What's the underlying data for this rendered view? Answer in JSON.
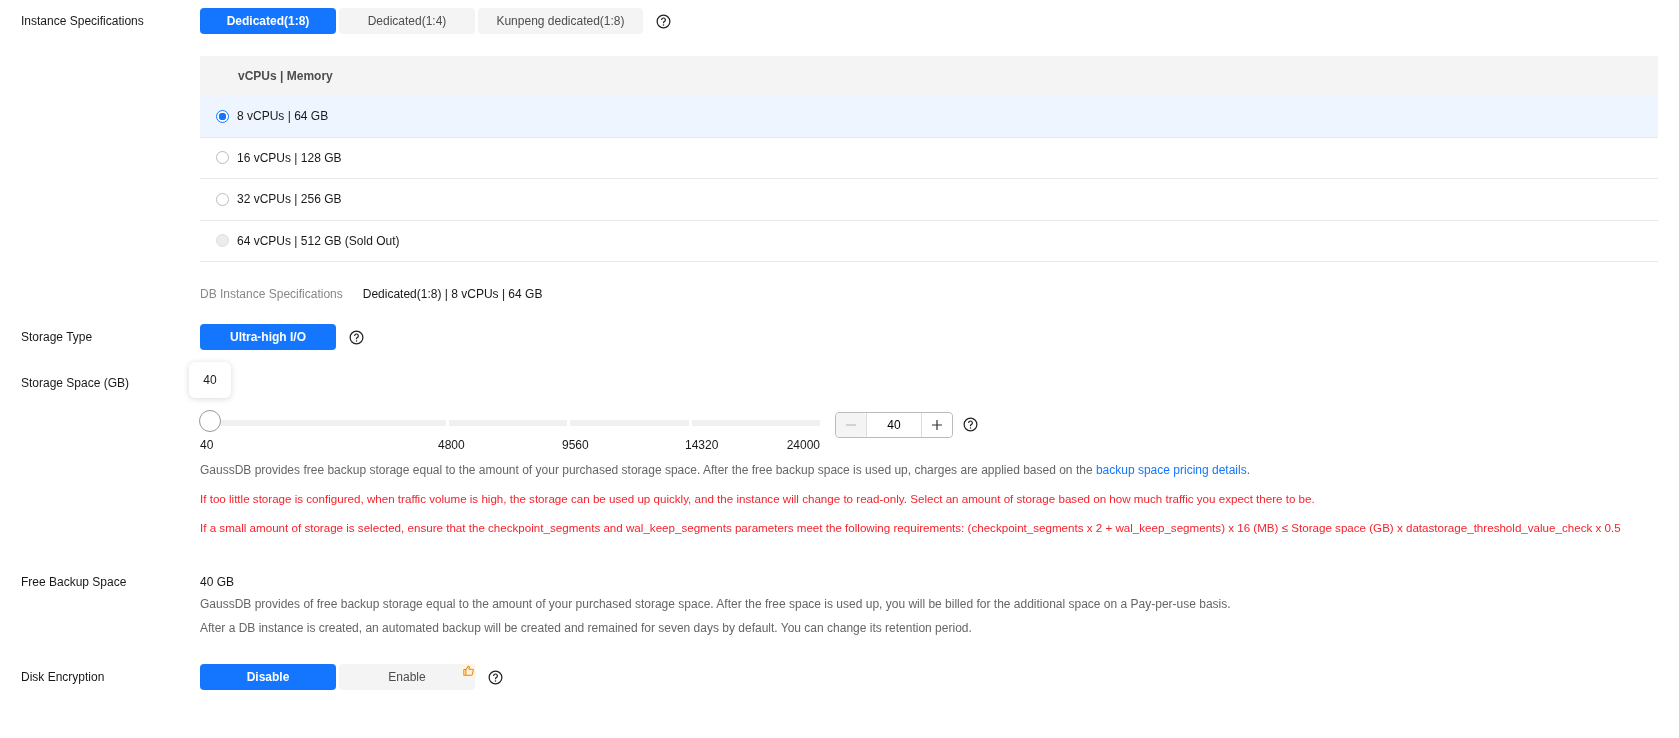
{
  "instance_specifications": {
    "label": "Instance Specifications",
    "options": [
      {
        "label": "Dedicated(1:8)",
        "selected": true
      },
      {
        "label": "Dedicated(1:4)",
        "selected": false
      },
      {
        "label": "Kunpeng dedicated(1:8)",
        "selected": false
      }
    ],
    "table": {
      "header": "vCPUs | Memory",
      "rows": [
        {
          "label": "8 vCPUs | 64 GB",
          "selected": true,
          "disabled": false
        },
        {
          "label": "16 vCPUs | 128 GB",
          "selected": false,
          "disabled": false
        },
        {
          "label": "32 vCPUs | 256 GB",
          "selected": false,
          "disabled": false
        },
        {
          "label": "64 vCPUs | 512 GB (Sold Out)",
          "selected": false,
          "disabled": true
        }
      ]
    },
    "summary": {
      "label": "DB Instance Specifications",
      "value": "Dedicated(1:8) | 8 vCPUs | 64 GB"
    }
  },
  "storage_type": {
    "label": "Storage Type",
    "options": [
      {
        "label": "Ultra-high I/O",
        "selected": true
      }
    ]
  },
  "storage_space": {
    "label": "Storage Space (GB)",
    "tooltip": "40",
    "level": 0,
    "ticks": [
      "40",
      "4800",
      "9560",
      "14320",
      "24000"
    ],
    "stepper": {
      "value": "40",
      "minus_disabled": true
    },
    "notes": [
      {
        "kind": "info",
        "text": "GaussDB provides free backup storage equal to the amount of your purchased storage space. After the free backup space is used up, charges are applied based on the ",
        "link": "backup space pricing details",
        "after": "."
      },
      {
        "kind": "warning",
        "text": "If too little storage is configured, when traffic volume is high, the storage can be used up quickly, and the instance will change to read-only. Select an amount of storage based on how much traffic you expect there to be."
      },
      {
        "kind": "warning",
        "text": "If a small amount of storage is selected, ensure that the checkpoint_segments and wal_keep_segments parameters meet the following requirements: (checkpoint_segments x 2 + wal_keep_segments) x 16 (MB) ≤ Storage space (GB) x datastorage_threshold_value_check x 0.5"
      }
    ]
  },
  "free_backup_space": {
    "label": "Free Backup Space",
    "value": "40 GB",
    "notes": [
      "GaussDB provides of free backup storage equal to the amount of your purchased storage space. After the free space is used up, you will be billed for the additional space on a Pay-per-use basis.",
      "After a DB instance is created, an automated backup will be created and remained for seven days by default. You can change its retention period."
    ]
  },
  "disk_encryption": {
    "label": "Disk Encryption",
    "options": [
      {
        "label": "Disable",
        "selected": true,
        "recommended": false
      },
      {
        "label": "Enable",
        "selected": false,
        "recommended": true
      }
    ]
  }
}
